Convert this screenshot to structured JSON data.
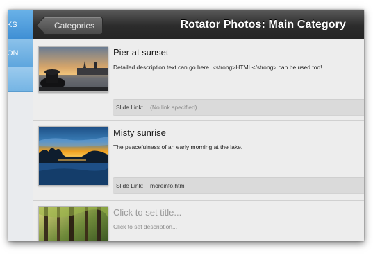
{
  "sidebar": {
    "items": [
      {
        "label": "KS"
      },
      {
        "label": "ON"
      },
      {
        "label": ""
      }
    ]
  },
  "header": {
    "back_label": "Categories",
    "title": "Rotator Photos: Main Category"
  },
  "slides": [
    {
      "title": "Pier at sunset",
      "description": "Detailed description text can go here. <strong>HTML</strong> can be used too!",
      "link_label": "Slide Link:",
      "link_value": "(No link specified)",
      "thumb_icon": "pier-sunset-photo"
    },
    {
      "title": "Misty sunrise",
      "description": "The peacefulness of an early morning at the lake.",
      "link_label": "Slide Link:",
      "link_value": "moreinfo.html",
      "thumb_icon": "lake-sunrise-photo"
    },
    {
      "title": "Click to set title...",
      "description": "Click to set description...",
      "thumb_icon": "forest-photo"
    }
  ]
}
